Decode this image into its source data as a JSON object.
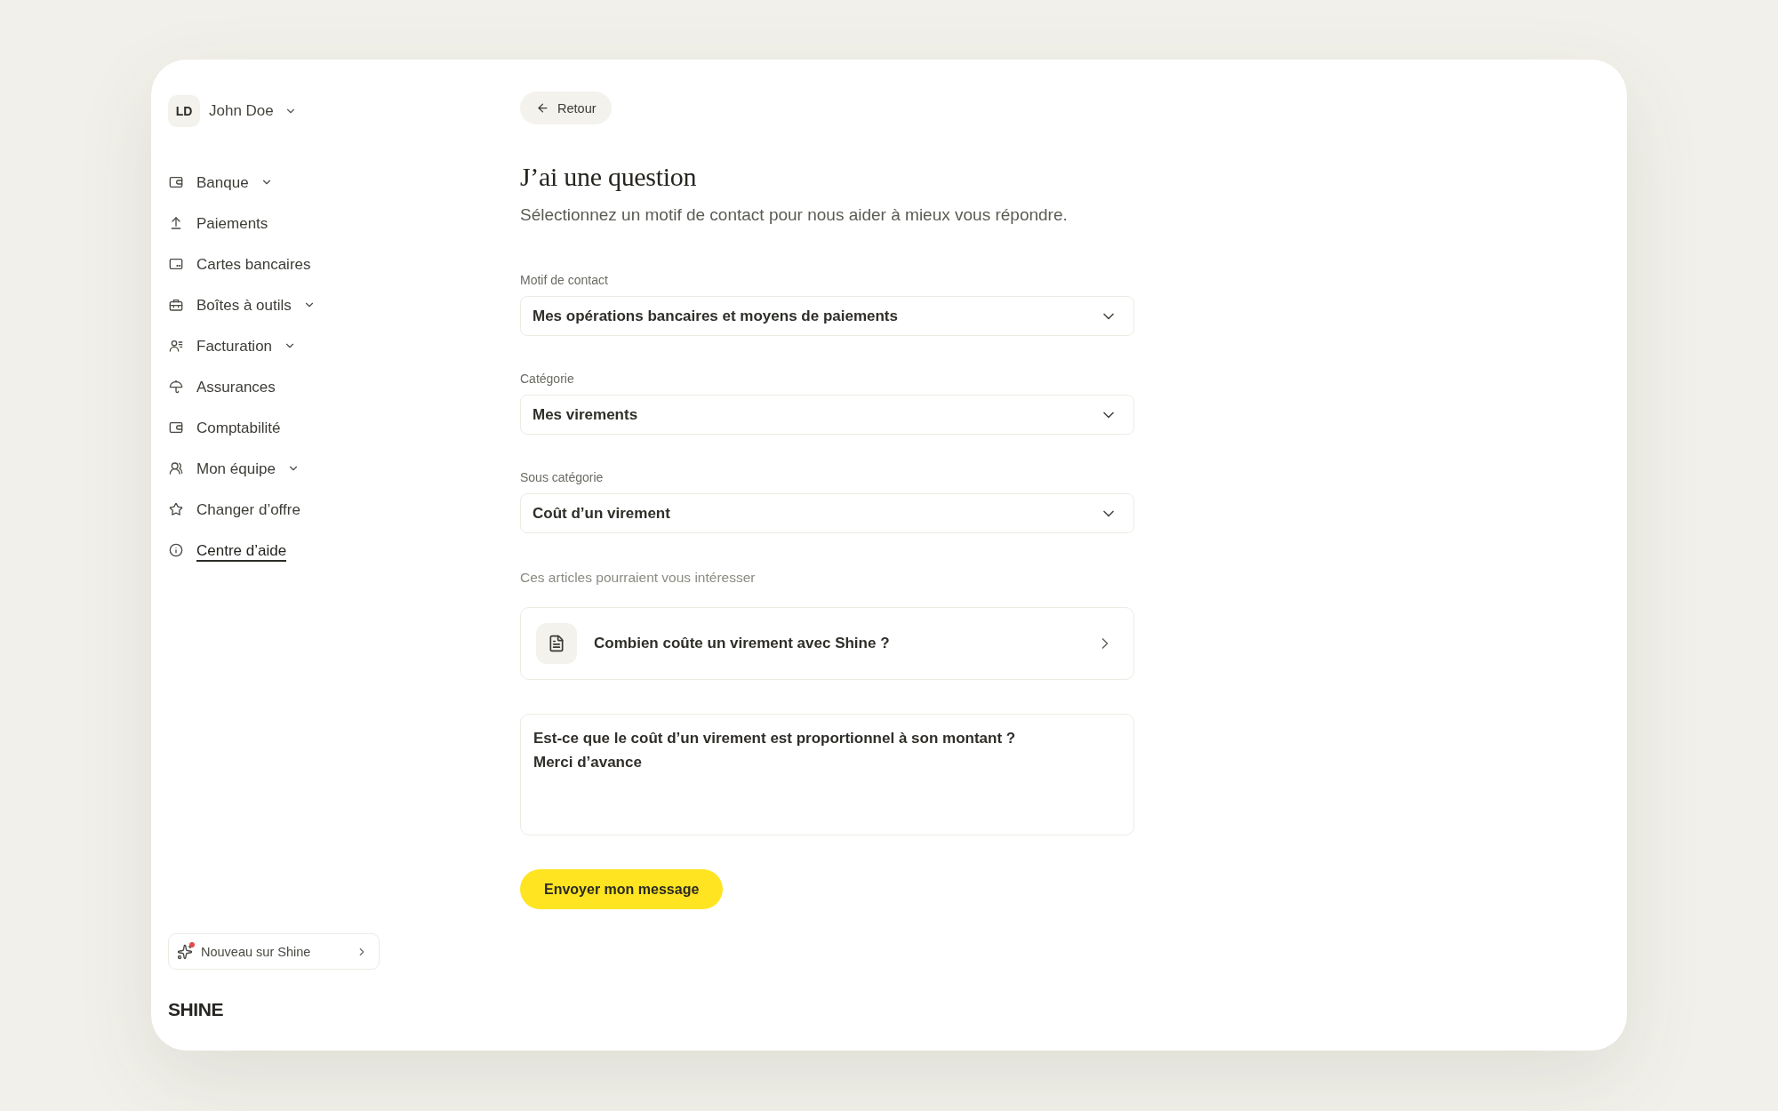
{
  "sidebar": {
    "account": {
      "initials": "LD",
      "name": "John Doe"
    },
    "nav_items": [
      {
        "label": "Banque",
        "submenu": true,
        "selected": false
      },
      {
        "label": "Paiements",
        "submenu": false,
        "selected": false
      },
      {
        "label": "Cartes bancaires",
        "submenu": false,
        "selected": false
      },
      {
        "label": "Boîtes à outils",
        "submenu": true,
        "selected": false
      },
      {
        "label": "Facturation",
        "submenu": true,
        "selected": false
      },
      {
        "label": "Assurances",
        "submenu": false,
        "selected": false
      },
      {
        "label": "Comptabilité",
        "submenu": false,
        "selected": false
      },
      {
        "label": "Mon équipe",
        "submenu": true,
        "selected": false
      },
      {
        "label": "Changer d’offre",
        "submenu": false,
        "selected": false
      },
      {
        "label": "Centre d’aide",
        "submenu": false,
        "selected": true
      }
    ],
    "whats_new": {
      "label": "Nouveau sur Shine",
      "unread": true
    },
    "logo": "SHINE"
  },
  "main": {
    "back_button": "Retour",
    "title": "J’ai une question",
    "subtitle": "Sélectionnez un motif de contact pour nous aider à mieux vous répondre.",
    "fields": [
      {
        "label": "Motif de contact",
        "value": "Mes opérations bancaires et moyens de paiements"
      },
      {
        "label": "Catégorie",
        "value": "Mes virements"
      },
      {
        "label": "Sous catégorie",
        "value": "Coût d’un virement"
      }
    ],
    "articles": {
      "heading": "Ces articles pourraient vous intéresser",
      "items": [
        {
          "title": "Combien coûte un virement avec Shine ?"
        }
      ]
    },
    "message": {
      "value": "Est-ce que le coût d’un virement est proportionnel à son montant ?\nMerci d’avance"
    },
    "submit_button": "Envoyer mon message"
  }
}
